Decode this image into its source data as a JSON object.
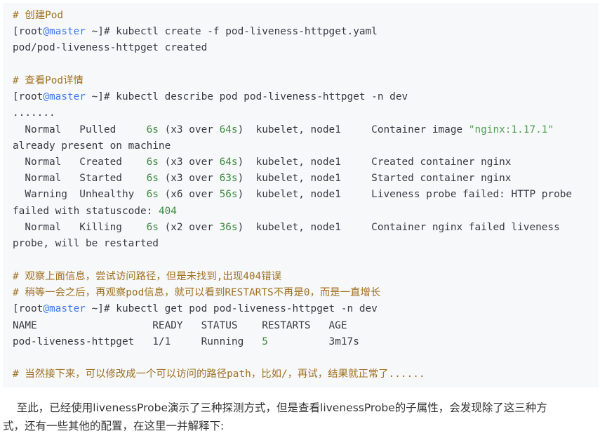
{
  "code": {
    "l1": "# 创建Pod",
    "l2_prompt": "[root",
    "l2_at": "@master",
    "l2_rest": " ~]# kubectl create -f pod-liveness-httpget.yaml",
    "l3": "pod/pod-liveness-httpget created",
    "l5": "# 查看Pod详情",
    "l6_prompt": "[root",
    "l6_at": "@master",
    "l6_rest": " ~]# kubectl describe pod pod-liveness-httpget -n dev",
    "l7": ".......",
    "l8_a": "  Normal   Pulled     ",
    "l8_n1": "6s",
    "l8_b": " (x3 over ",
    "l8_n2": "64s",
    "l8_c": ")  kubelet, node1     Container image ",
    "l8_str": "\"nginx:1.17.1\"",
    "l9": "already present on machine",
    "l10_a": "  Normal   Created    ",
    "l10_n1": "6s",
    "l10_b": " (x3 over ",
    "l10_n2": "64s",
    "l10_c": ")  kubelet, node1     Created container nginx",
    "l11_a": "  Normal   Started    ",
    "l11_n1": "6s",
    "l11_b": " (x3 over ",
    "l11_n2": "63s",
    "l11_c": ")  kubelet, node1     Started container nginx",
    "l12_a": "  Warning  Unhealthy  ",
    "l12_n1": "6s",
    "l12_b": " (x6 over ",
    "l12_n2": "56s",
    "l12_c": ")  kubelet, node1     Liveness probe failed: HTTP probe",
    "l13_a": "failed with statuscode: ",
    "l13_n": "404",
    "l14_a": "  Normal   Killing    ",
    "l14_n1": "6s",
    "l14_b": " (x2 over ",
    "l14_n2": "36s",
    "l14_c": ")  kubelet, node1     Container nginx failed liveness",
    "l15": "probe, will be restarted",
    "l17": "# 观察上面信息，尝试访问路径，但是未找到,出现404错误",
    "l18": "# 稍等一会之后，再观察pod信息，就可以看到RESTARTS不再是0，而是一直增长",
    "l19_prompt": "[root",
    "l19_at": "@master",
    "l19_rest": " ~]# kubectl get pod pod-liveness-httpget -n dev",
    "l20": "NAME                   READY   STATUS    RESTARTS   AGE",
    "l21_a": "pod-liveness-httpget   1/1     Running   ",
    "l21_n": "5",
    "l21_b": "          3m17s",
    "l23": "# 当然接下来，可以修改成一个可以访问的路径path，比如/，再试，结果就正常了......"
  },
  "prose": {
    "line1": "    至此，已经使用livenessProbe演示了三种探测方式，但是查看livenessProbe的子属性，会发现除了这三种方",
    "line2": "式，还有一些其他的配置，在这里一并解释下:"
  }
}
